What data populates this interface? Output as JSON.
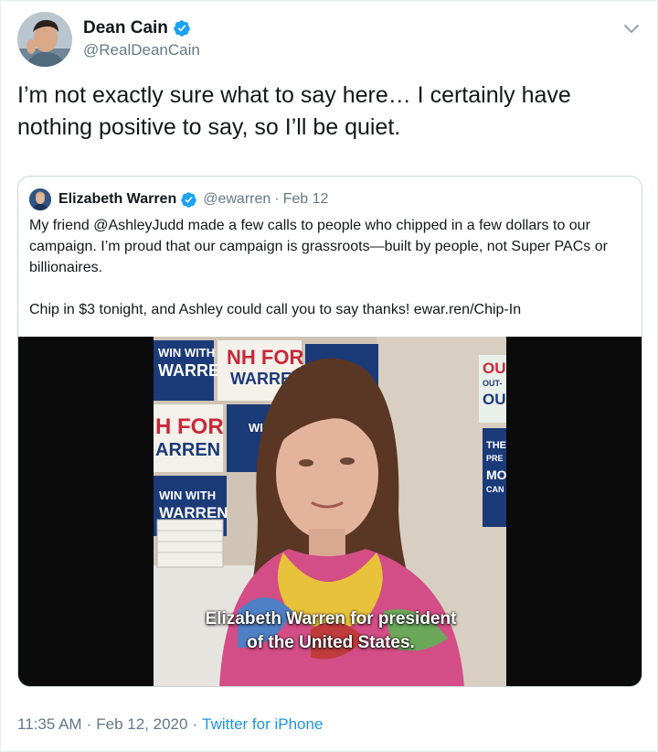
{
  "tweet": {
    "author_name": "Dean Cain",
    "author_handle": "@RealDeanCain",
    "text": "I’m not exactly sure what to say here…  I certainly have nothing positive to say, so I’ll be quiet.",
    "time": "11:35 AM",
    "date": "Feb 12, 2020",
    "source": "Twitter for iPhone",
    "separator": "·"
  },
  "quoted": {
    "author_name": "Elizabeth Warren",
    "author_handle": "@ewarren",
    "date": "Feb 12",
    "separator": "·",
    "paragraph1": "My friend @AshleyJudd made a few calls to people who chipped in a few dollars to our campaign. I’m proud that our campaign is grassroots—built by people, not Super PACs or billionaires.",
    "paragraph2": "Chip in $3 tonight, and Ashley could call you to say thanks! ewar.ren/Chip-In",
    "video": {
      "caption_line1": "Elizabeth Warren for president",
      "caption_line2": "of the United States.",
      "signs": {
        "s1a": "WIN WITH",
        "s1b": "WARREN",
        "s2a": "NH FOR",
        "s2b": "WARREN",
        "s3a": "H FOR",
        "s3b": "ARREN",
        "s4": "WIN",
        "s5a": "WIN WITH",
        "s5b": "WARREN",
        "s6a": "OU",
        "s6b": "OUT-",
        "s6c": "OU",
        "s7a": "THE",
        "s7b": "PRE",
        "s7c": "MO",
        "s7d": "CAN"
      }
    }
  },
  "colors": {
    "verified_blue": "#1da1f2",
    "link_blue": "#1b95e0",
    "secondary_text": "#657786"
  }
}
